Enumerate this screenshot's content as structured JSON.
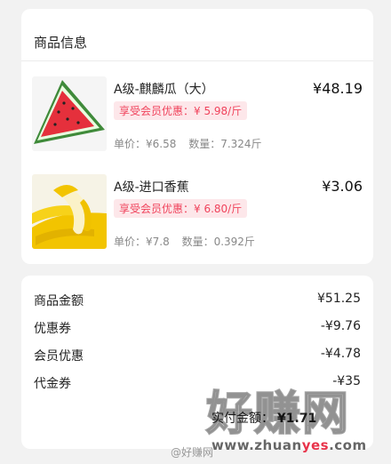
{
  "order_section": {
    "title": "商品信息",
    "items": [
      {
        "name": "A级-麒麟瓜（大）",
        "price": "¥48.19",
        "member_discount": "享受会员优惠：¥ 5.98/斤",
        "unit_price": "单价：¥6.58",
        "quantity": "数量：7.324斤",
        "image_icon": "watermelon-image"
      },
      {
        "name": "A级-进口香蕉",
        "price": "¥3.06",
        "member_discount": "享受会员优惠：¥ 6.80/斤",
        "unit_price": "单价：¥7.8",
        "quantity": "数量：0.392斤",
        "image_icon": "banana-image"
      }
    ]
  },
  "summary": {
    "rows": [
      {
        "label": "商品金额",
        "value": "¥51.25"
      },
      {
        "label": "优惠券",
        "value": "-¥9.76"
      },
      {
        "label": "会员优惠",
        "value": "-¥4.78"
      },
      {
        "label": "代金券",
        "value": "-¥35"
      }
    ],
    "paid_label": "实付金额：",
    "paid_value": "¥1.71"
  },
  "watermark": {
    "logo": "好赚网",
    "url_prefix": "www.zhuan",
    "url_highlight": "yes",
    "url_suffix": ".com",
    "weibo": "@好赚网"
  },
  "colors": {
    "accent_pink_bg": "#fde7ea",
    "accent_pink_text": "#f0435c",
    "page_bg": "#f2f2f2"
  }
}
